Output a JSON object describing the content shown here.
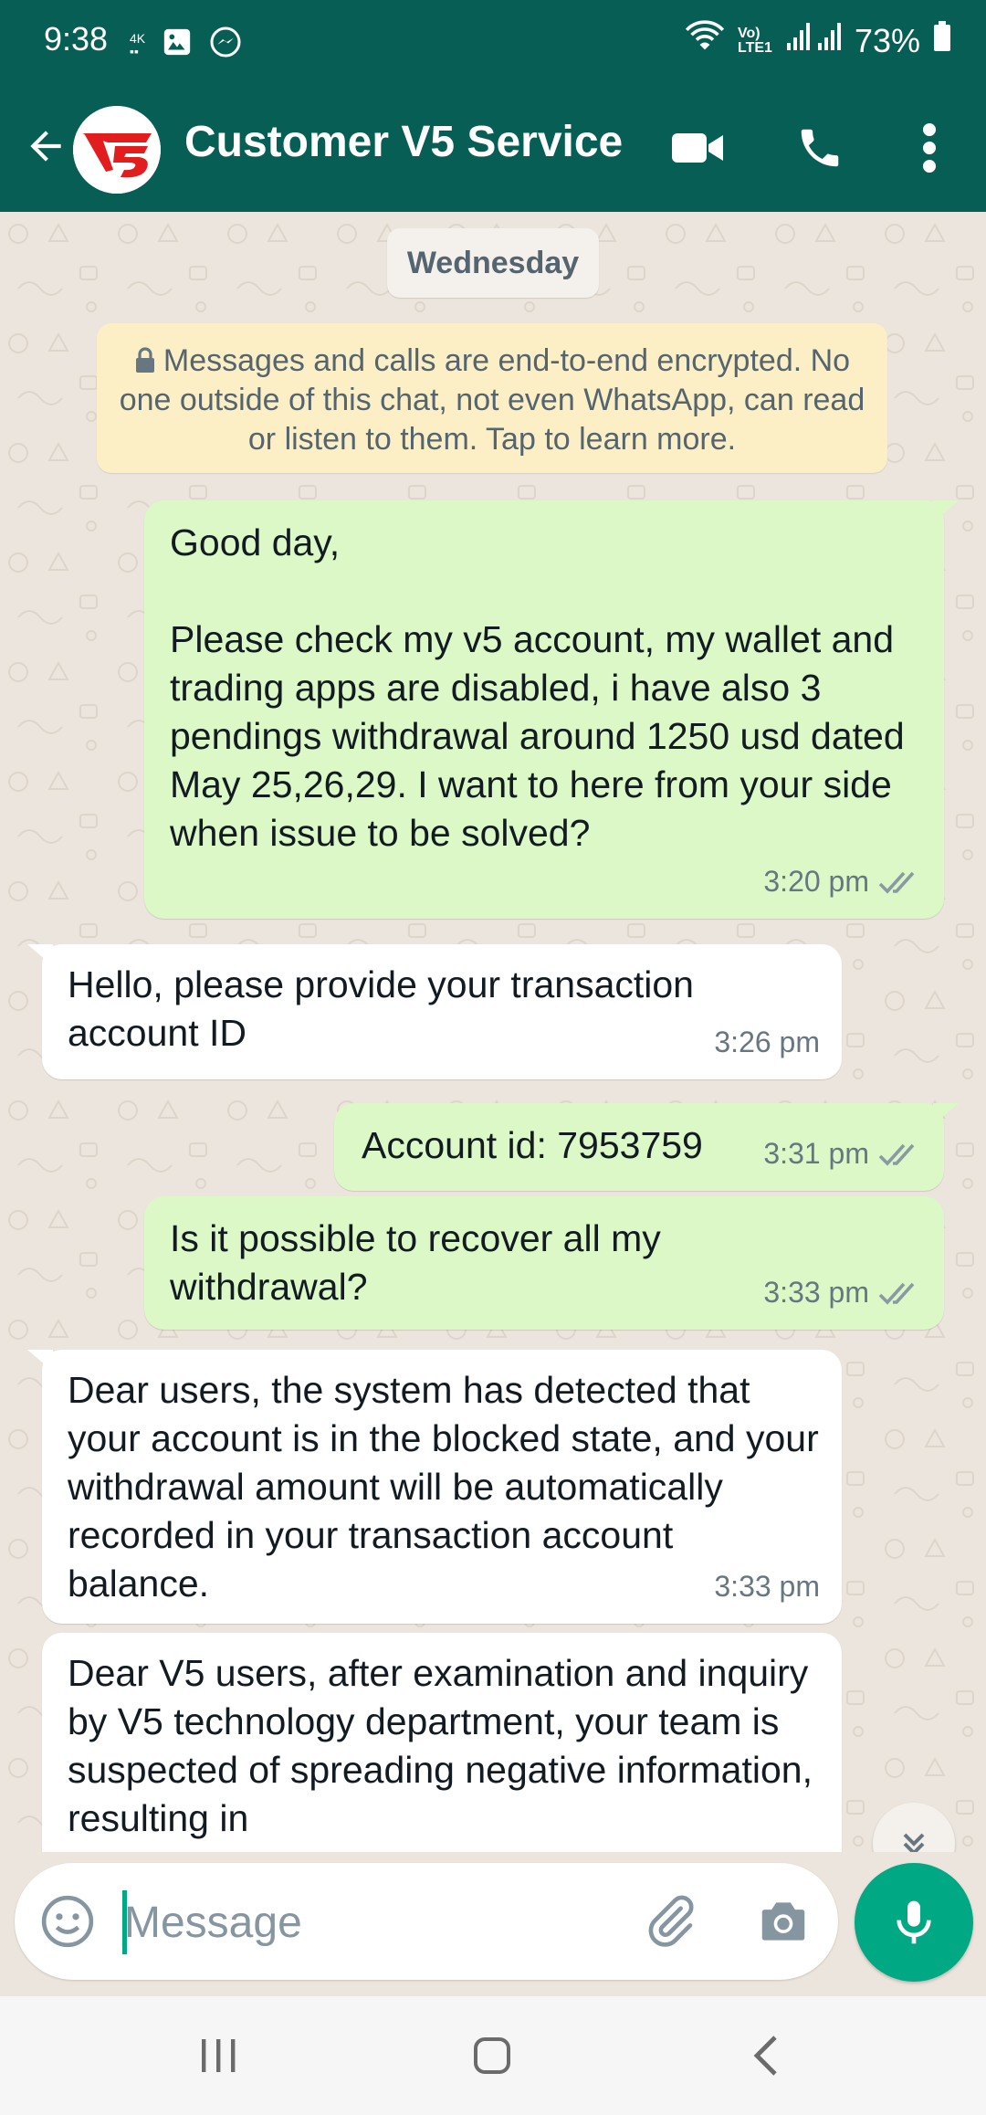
{
  "status_bar": {
    "time": "9:38",
    "battery": "73%",
    "icons": [
      "4k-recording-icon",
      "gallery-icon",
      "messenger-icon",
      "wifi-icon",
      "volte-icon",
      "signal-icon",
      "battery-icon"
    ]
  },
  "header": {
    "title": "Customer V5 Service",
    "avatar_text": "V5",
    "colors": {
      "header_bg": "#075e54",
      "avatar_red": "#e11d1d"
    }
  },
  "chat": {
    "date_chip": "Wednesday",
    "encryption_note": "Messages and calls are end-to-end encrypted. No one outside of this chat, not even WhatsApp, can read or listen to them. Tap to learn more.",
    "messages": [
      {
        "direction": "out",
        "text": "Good day,\n\nPlease check my v5 account, my wallet and trading apps are disabled, i have also 3 pendings withdrawal around 1250 usd dated May 25,26,29. I want to here from your side when issue to be solved?",
        "time": "3:20 pm",
        "status": "read"
      },
      {
        "direction": "in",
        "text": "Hello, please provide your transaction\naccount ID",
        "time": "3:26 pm"
      },
      {
        "direction": "out",
        "text": "Account id: 7953759",
        "time": "3:31 pm",
        "status": "read"
      },
      {
        "direction": "out",
        "text": "Is it possible to recover all my\nwithdrawal?",
        "time": "3:33 pm",
        "status": "read"
      },
      {
        "direction": "in",
        "text": "Dear users, the system has detected that your account is in the blocked state, and your withdrawal amount will be automatically recorded in your transaction account balance.",
        "time": "3:33 pm"
      },
      {
        "direction": "in",
        "text": "Dear V5 users, after examination and inquiry by V5 technology department, your team is suspected of spreading negative information, resulting in",
        "time": ""
      }
    ],
    "colors": {
      "outgoing_bubble": "#dcf8c6",
      "incoming_bubble": "#ffffff",
      "read_ticks": "#8a9aa3"
    }
  },
  "composer": {
    "placeholder": "Message",
    "colors": {
      "mic_button": "#00a884"
    }
  },
  "nav_bar": {
    "buttons": [
      "recent-apps-icon",
      "home-icon",
      "back-icon"
    ]
  }
}
